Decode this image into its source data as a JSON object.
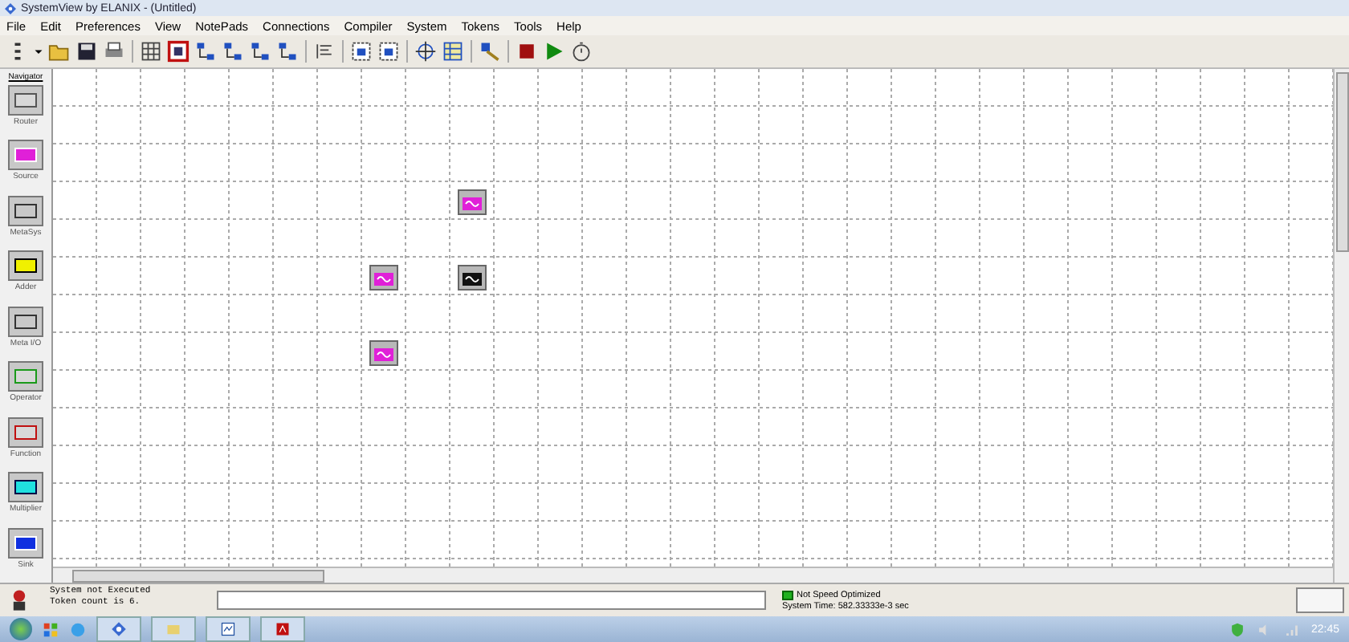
{
  "window": {
    "title": "SystemView by ELANIX - (Untitled)"
  },
  "menu": [
    "File",
    "Edit",
    "Preferences",
    "View",
    "NotePads",
    "Connections",
    "Compiler",
    "System",
    "Tokens",
    "Tools",
    "Help"
  ],
  "navigator": {
    "title": "Navigator",
    "items": [
      {
        "label": "Router",
        "kind": "router"
      },
      {
        "label": "Source",
        "kind": "source"
      },
      {
        "label": "MetaSys",
        "kind": "metasys"
      },
      {
        "label": "Adder",
        "kind": "adder"
      },
      {
        "label": "Meta I/O",
        "kind": "metaio"
      },
      {
        "label": "Operator",
        "kind": "operator"
      },
      {
        "label": "Function",
        "kind": "function"
      },
      {
        "label": "Multiplier",
        "kind": "multiplier"
      },
      {
        "label": "Sink",
        "kind": "sink"
      }
    ]
  },
  "tokens": [
    {
      "kind": "source"
    },
    {
      "kind": "source"
    },
    {
      "kind": "sink"
    },
    {
      "kind": "source"
    }
  ],
  "status": {
    "messages": [
      "System not Executed",
      "Token count is 6."
    ],
    "speed": "Not Speed Optimized",
    "system_time": "System Time: 582.33333e-3 sec"
  },
  "taskbar": {
    "clock": "22:45"
  }
}
